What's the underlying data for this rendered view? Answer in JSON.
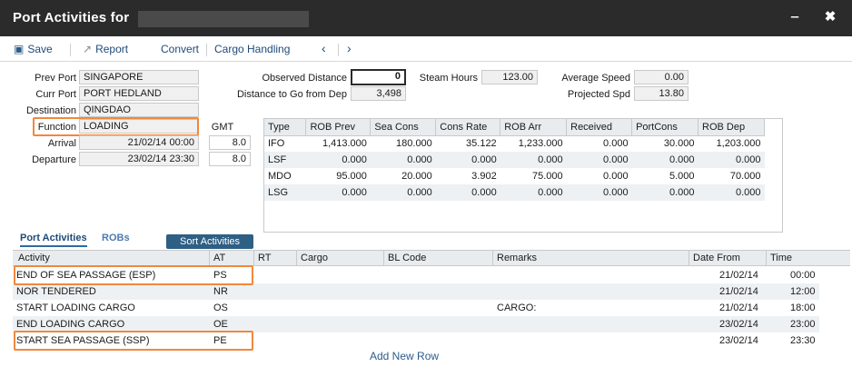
{
  "window": {
    "title": "Port Activities for"
  },
  "toolbar": {
    "save": "Save",
    "report": "Report",
    "convert": "Convert",
    "cargo_handling": "Cargo Handling"
  },
  "voyage": {
    "prev_port_label": "Prev Port",
    "prev_port": "SINGAPORE",
    "curr_port_label": "Curr Port",
    "curr_port": "PORT HEDLAND",
    "destination_label": "Destination",
    "destination": "QINGDAO",
    "function_label": "Function",
    "function": "LOADING",
    "arrival_label": "Arrival",
    "arrival": "21/02/14 00:00",
    "arrival_gmt": "8.0",
    "departure_label": "Departure",
    "departure": "23/02/14 23:30",
    "departure_gmt": "8.0",
    "gmt_label": "GMT"
  },
  "distance": {
    "observed_label": "Observed Distance",
    "observed": "0",
    "to_go_label": "Distance to Go from Dep",
    "to_go": "3,498",
    "steam_hours_label": "Steam Hours",
    "steam_hours": "123.00",
    "avg_speed_label": "Average Speed",
    "avg_speed": "0.00",
    "proj_speed_label": "Projected Spd",
    "proj_speed": "13.80"
  },
  "fuel": {
    "headers": [
      "Type",
      "ROB Prev",
      "Sea Cons",
      "Cons Rate",
      "ROB Arr",
      "Received",
      "PortCons",
      "ROB Dep"
    ],
    "rows": [
      [
        "IFO",
        "1,413.000",
        "180.000",
        "35.122",
        "1,233.000",
        "0.000",
        "30.000",
        "1,203.000"
      ],
      [
        "LSF",
        "0.000",
        "0.000",
        "0.000",
        "0.000",
        "0.000",
        "0.000",
        "0.000"
      ],
      [
        "MDO",
        "95.000",
        "20.000",
        "3.902",
        "75.000",
        "0.000",
        "5.000",
        "70.000"
      ],
      [
        "LSG",
        "0.000",
        "0.000",
        "0.000",
        "0.000",
        "0.000",
        "0.000",
        "0.000"
      ]
    ]
  },
  "tabs": {
    "port_activities": "Port Activities",
    "robs": "ROBs",
    "sort": "Sort Activities"
  },
  "activities": {
    "headers": {
      "activity": "Activity",
      "at": "AT",
      "rt": "RT",
      "cargo": "Cargo",
      "bl_code": "BL Code",
      "remarks": "Remarks",
      "date_from": "Date From",
      "time": "Time"
    },
    "rows": [
      {
        "activity": "END OF SEA PASSAGE (ESP)",
        "at": "PS",
        "remarks": "",
        "date": "21/02/14",
        "time": "00:00"
      },
      {
        "activity": "NOR TENDERED",
        "at": "NR",
        "remarks": "",
        "date": "21/02/14",
        "time": "12:00"
      },
      {
        "activity": "START LOADING CARGO",
        "at": "OS",
        "remarks": "CARGO:",
        "date": "21/02/14",
        "time": "18:00"
      },
      {
        "activity": "END LOADING CARGO",
        "at": "OE",
        "remarks": "",
        "date": "23/02/14",
        "time": "23:00"
      },
      {
        "activity": "START SEA PASSAGE (SSP)",
        "at": "PE",
        "remarks": "",
        "date": "23/02/14",
        "time": "23:30"
      }
    ],
    "add_row": "Add New Row"
  },
  "colors": {
    "titlebar": "#2b2b2b",
    "accent": "#2e5f84",
    "highlight": "#f0883e"
  }
}
